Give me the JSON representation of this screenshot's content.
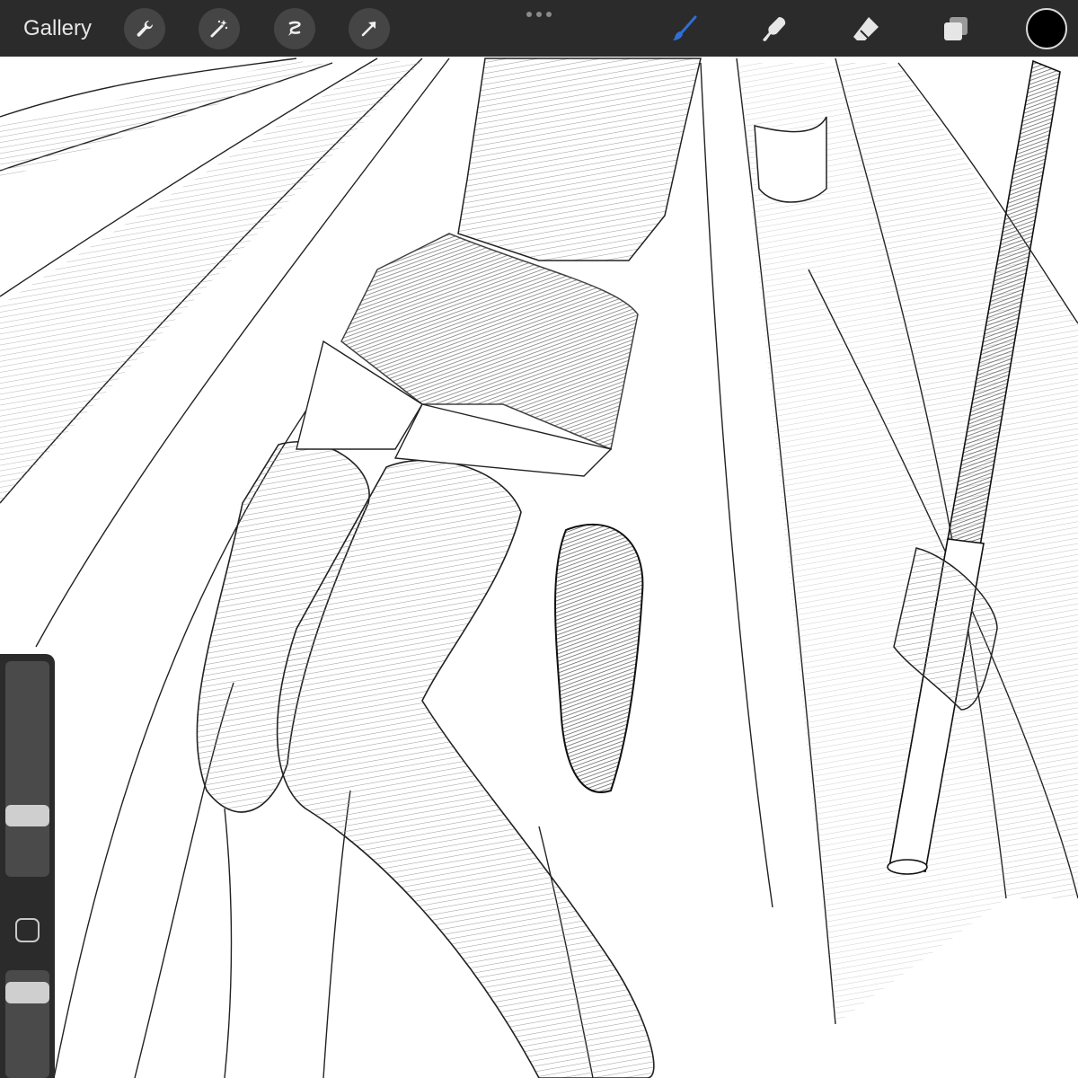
{
  "toolbar": {
    "gallery_label": "Gallery",
    "left_tools": [
      "wrench-icon",
      "magic-wand-icon",
      "selection-icon",
      "transform-arrow-icon"
    ],
    "more_icon": "more-dots-icon",
    "right_tools": [
      "brush-icon",
      "smudge-icon",
      "eraser-icon",
      "layers-icon"
    ],
    "active_tool": "brush-icon",
    "active_color": "#000000",
    "accent_color": "#2f6fd6"
  },
  "sidebar": {
    "brush_size_slider": {
      "value": 0.26
    },
    "modify_button_icon": "square-outline-icon",
    "opacity_slider": {
      "value": 0.86
    }
  },
  "canvas": {
    "description_icon": "pencil-sketch-artwork"
  }
}
